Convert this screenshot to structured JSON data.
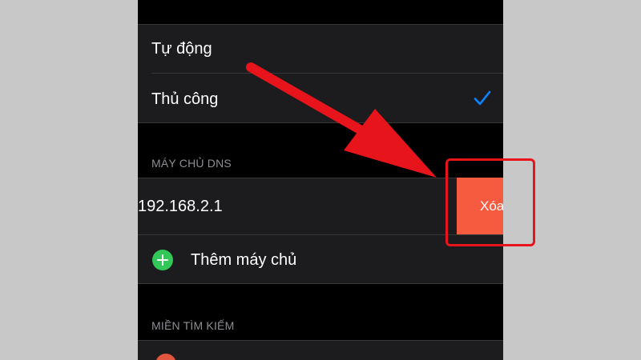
{
  "ip_mode": {
    "options": [
      {
        "label": "Tự động"
      },
      {
        "label": "Thủ công",
        "selected": true
      }
    ]
  },
  "dns": {
    "section_header": "MÁY CHỦ DNS",
    "servers": [
      "192.168.2.1"
    ],
    "delete_label": "Xóa",
    "add_label": "Thêm máy chủ"
  },
  "search_domains": {
    "section_header": "MIỀN TÌM KIẾM"
  },
  "colors": {
    "background": "#000000",
    "cell": "#1c1c1e",
    "checkmark": "#0a84ff",
    "delete": "#f65a3f",
    "add": "#33c659",
    "annotation": "#e8141b"
  },
  "icons": {
    "checkmark": "checkmark-icon",
    "add": "plus-circle-icon",
    "annotation_arrow": "arrow-annotation"
  }
}
